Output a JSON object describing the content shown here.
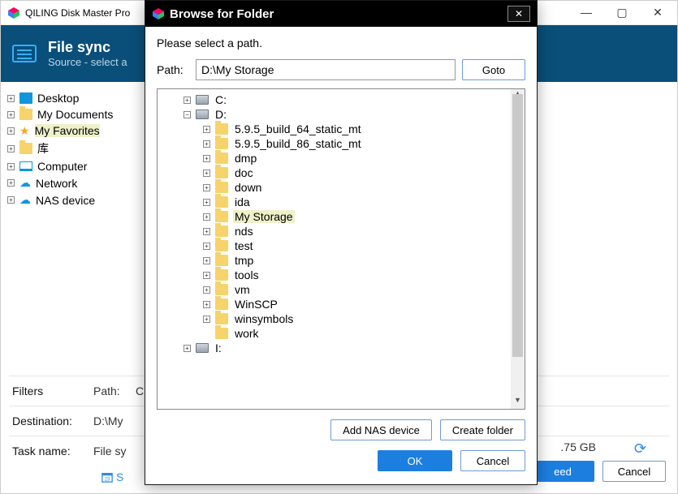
{
  "main_title": "QILING Disk Master Pro",
  "band": {
    "title": "File sync",
    "subtitle": "Source - select a"
  },
  "side_tree": [
    {
      "name": "desktop",
      "label": "Desktop",
      "icon": "desktop"
    },
    {
      "name": "my-documents",
      "label": "My Documents",
      "icon": "folder"
    },
    {
      "name": "my-favorites",
      "label": "My Favorites",
      "icon": "star",
      "selected": true
    },
    {
      "name": "library",
      "label": "库",
      "icon": "folder"
    },
    {
      "name": "computer",
      "label": "Computer",
      "icon": "monitor"
    },
    {
      "name": "network",
      "label": "Network",
      "icon": "net"
    },
    {
      "name": "nas-device",
      "label": "NAS device",
      "icon": "nas"
    }
  ],
  "filters": {
    "label": "Filters",
    "path_label": "Path:",
    "path_value": "C:\\"
  },
  "destination": {
    "label": "Destination:",
    "value": "D:\\My"
  },
  "taskname": {
    "label": "Task name:",
    "value": "File sy"
  },
  "size_text": ".75 GB",
  "schedule_label": "S",
  "main_buttons": {
    "proceed": "eed",
    "cancel": "Cancel"
  },
  "modal": {
    "title": "Browse for Folder",
    "instruction": "Please select a path.",
    "path_label": "Path:",
    "path_value": "D:\\My Storage",
    "goto": "Goto",
    "drives": [
      {
        "label": "C:",
        "expanded": false
      },
      {
        "label": "D:",
        "expanded": true
      }
    ],
    "d_children": [
      "5.9.5_build_64_static_mt",
      "5.9.5_build_86_static_mt",
      "dmp",
      "doc",
      "down",
      "ida",
      "My Storage",
      "nds",
      "test",
      "tmp",
      "tools",
      "vm",
      "WinSCP",
      "winsymbols",
      "work"
    ],
    "selected_child": "My Storage",
    "tail_drive": "I:",
    "buttons": {
      "add_nas": "Add NAS device",
      "create_folder": "Create folder",
      "ok": "OK",
      "cancel": "Cancel"
    }
  }
}
